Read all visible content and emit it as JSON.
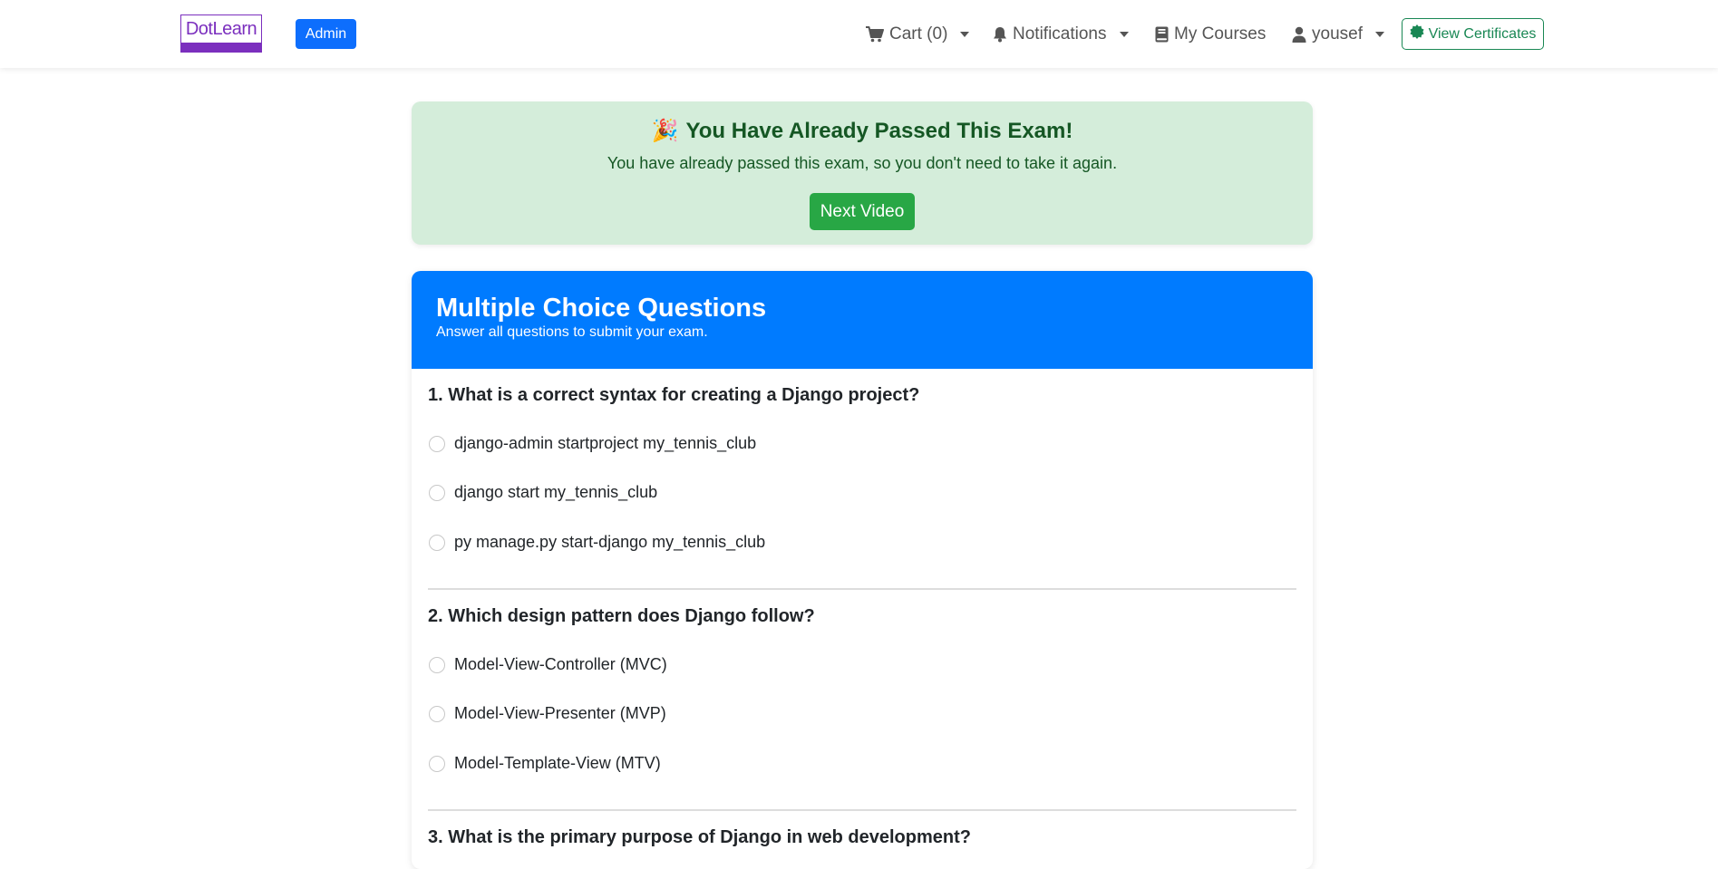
{
  "navbar": {
    "logo_text": "DotLearn",
    "admin_label": "Admin",
    "cart_label": "Cart (0)",
    "notifications_label": "Notifications",
    "courses_label": "My Courses",
    "user_label": "yousef",
    "certificates_label": "View Certificates"
  },
  "alert": {
    "emoji": "🎉",
    "title": "You Have Already Passed This Exam!",
    "message": "You have already passed this exam, so you don't need to take it again.",
    "button_label": "Next Video"
  },
  "exam": {
    "title": "Multiple Choice Questions",
    "subtitle": "Answer all questions to submit your exam.",
    "questions": [
      {
        "text": "1. What is a correct syntax for creating a Django project?",
        "options": [
          "django-admin startproject my_tennis_club",
          "django start my_tennis_club",
          "py manage.py start-django my_tennis_club"
        ]
      },
      {
        "text": "2. Which design pattern does Django follow?",
        "options": [
          "Model-View-Controller (MVC)",
          "Model-View-Presenter (MVP)",
          "Model-Template-View (MTV)"
        ]
      },
      {
        "text": "3. What is the primary purpose of Django in web development?",
        "options": []
      }
    ]
  },
  "colors": {
    "primary": "#0d6efd",
    "header_blue": "#007bff",
    "success": "#28a745",
    "success_text": "#155724",
    "success_bg": "#d4edda",
    "logo_purple": "#7b2fbe"
  },
  "icons": {
    "cart": "shopping-cart-icon",
    "notifications": "bell-icon",
    "courses": "book-icon",
    "user": "user-icon",
    "certificates": "badge-certificate-icon"
  }
}
